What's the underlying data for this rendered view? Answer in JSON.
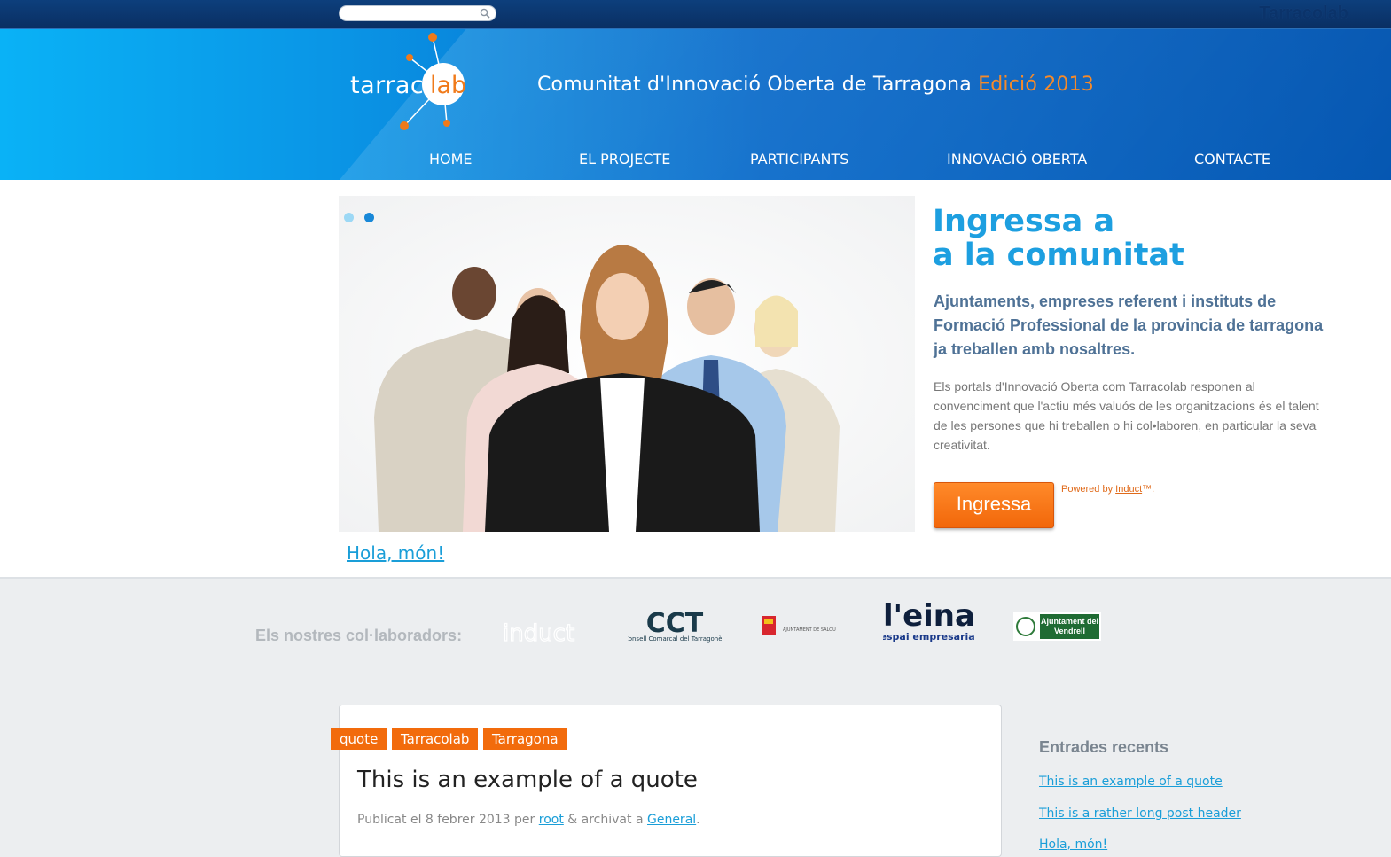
{
  "topbar": {
    "search_placeholder": "",
    "corner_title": "Tarracolab"
  },
  "header": {
    "logo_part1": "tarraco",
    "logo_part2": "lab",
    "tagline": "Comunitat d'Innovació Oberta de Tarragona",
    "edition": "Edició 2013",
    "nav": [
      "HOME",
      "EL PROJECTE",
      "PARTICIPANTS",
      "INNOVACIÓ OBERTA",
      "CONTACTE"
    ]
  },
  "hero": {
    "heading_line1": "Ingressa a",
    "heading_line2": "a la comunitat",
    "subtitle": "Ajuntaments, empreses referent i instituts de Formació Professional de la provincia de tarragona ja treballen amb nosaltres.",
    "body": "Els portals d'Innovació Oberta com Tarracolab responen al convenciment que l'actiu més valuós de les organitzacions és el talent de les persones que hi treballen o hi col•laboren, en particular la seva creativitat.",
    "button": "Ingressa",
    "powered_prefix": "Powered by",
    "powered_link": "Induct",
    "powered_suffix": "™.",
    "slide_link": "Hola, món!",
    "slides_count": 2,
    "active_slide": 2
  },
  "collaborators": {
    "label": "Els nostres col·laboradors:",
    "logos": [
      {
        "text": "induct"
      },
      {
        "text": "CCT",
        "subtext": "Consell Comarcal del Tarragonès"
      },
      {
        "text": "AJUNTAMENT DE SALOU"
      },
      {
        "text": "l'eina",
        "subtext": "espai empresarial"
      },
      {
        "text": "Ajuntament del Vendrell"
      }
    ]
  },
  "post": {
    "tags": [
      "quote",
      "Tarracolab",
      "Tarragona"
    ],
    "title": "This is an example of a quote",
    "meta_prefix": "Publicat el 8 febrer 2013 per",
    "author": "root",
    "meta_mid": "& archivat a",
    "category": "General",
    "meta_suffix": "."
  },
  "sidebar": {
    "heading": "Entrades recents",
    "items": [
      "This is an example of a quote",
      "This is a rather long post header",
      "Hola, món!"
    ]
  },
  "colors": {
    "accent_orange": "#f26b0c",
    "link_blue": "#1a9ed8",
    "header_blue": "#0567c8"
  }
}
